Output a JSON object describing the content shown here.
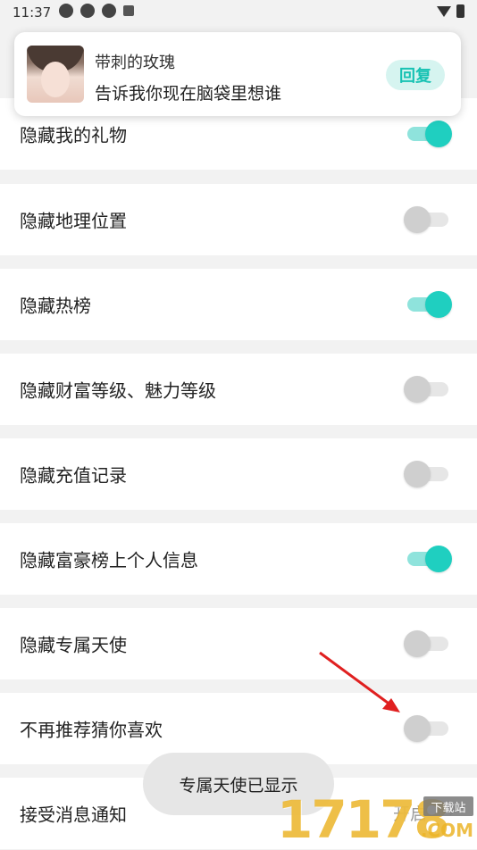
{
  "status_bar": {
    "time": "11:37",
    "icons": [
      "notification-icon",
      "notification-icon",
      "notification-icon",
      "a-icon"
    ],
    "right_icons": [
      "wifi-icon",
      "battery-icon"
    ]
  },
  "notification": {
    "sender": "带刺的玫瑰",
    "message": "告诉我你现在脑袋里想谁",
    "reply_label": "回复"
  },
  "settings": [
    {
      "label": "隐藏我的礼物",
      "on": true
    },
    {
      "label": "隐藏地理位置",
      "on": false
    },
    {
      "label": "隐藏热榜",
      "on": true
    },
    {
      "label": "隐藏财富等级、魅力等级",
      "on": false
    },
    {
      "label": "隐藏充值记录",
      "on": false
    },
    {
      "label": "隐藏富豪榜上个人信息",
      "on": true
    },
    {
      "label": "隐藏专属天使",
      "on": false
    },
    {
      "label": "不再推荐猜你喜欢",
      "on": false
    },
    {
      "label": "接受消息通知",
      "trail": "开启",
      "trail_icon": "chevron-right-icon"
    }
  ],
  "toast": "专属天使已显示",
  "watermark": {
    "digits": "17178",
    "badge": "下载站",
    "domain": ".COM"
  },
  "colors": {
    "accent": "#1fcfc0",
    "accent_light": "#8fe3dc",
    "reply_bg": "#d6f4f0",
    "arrow": "#e02020"
  }
}
